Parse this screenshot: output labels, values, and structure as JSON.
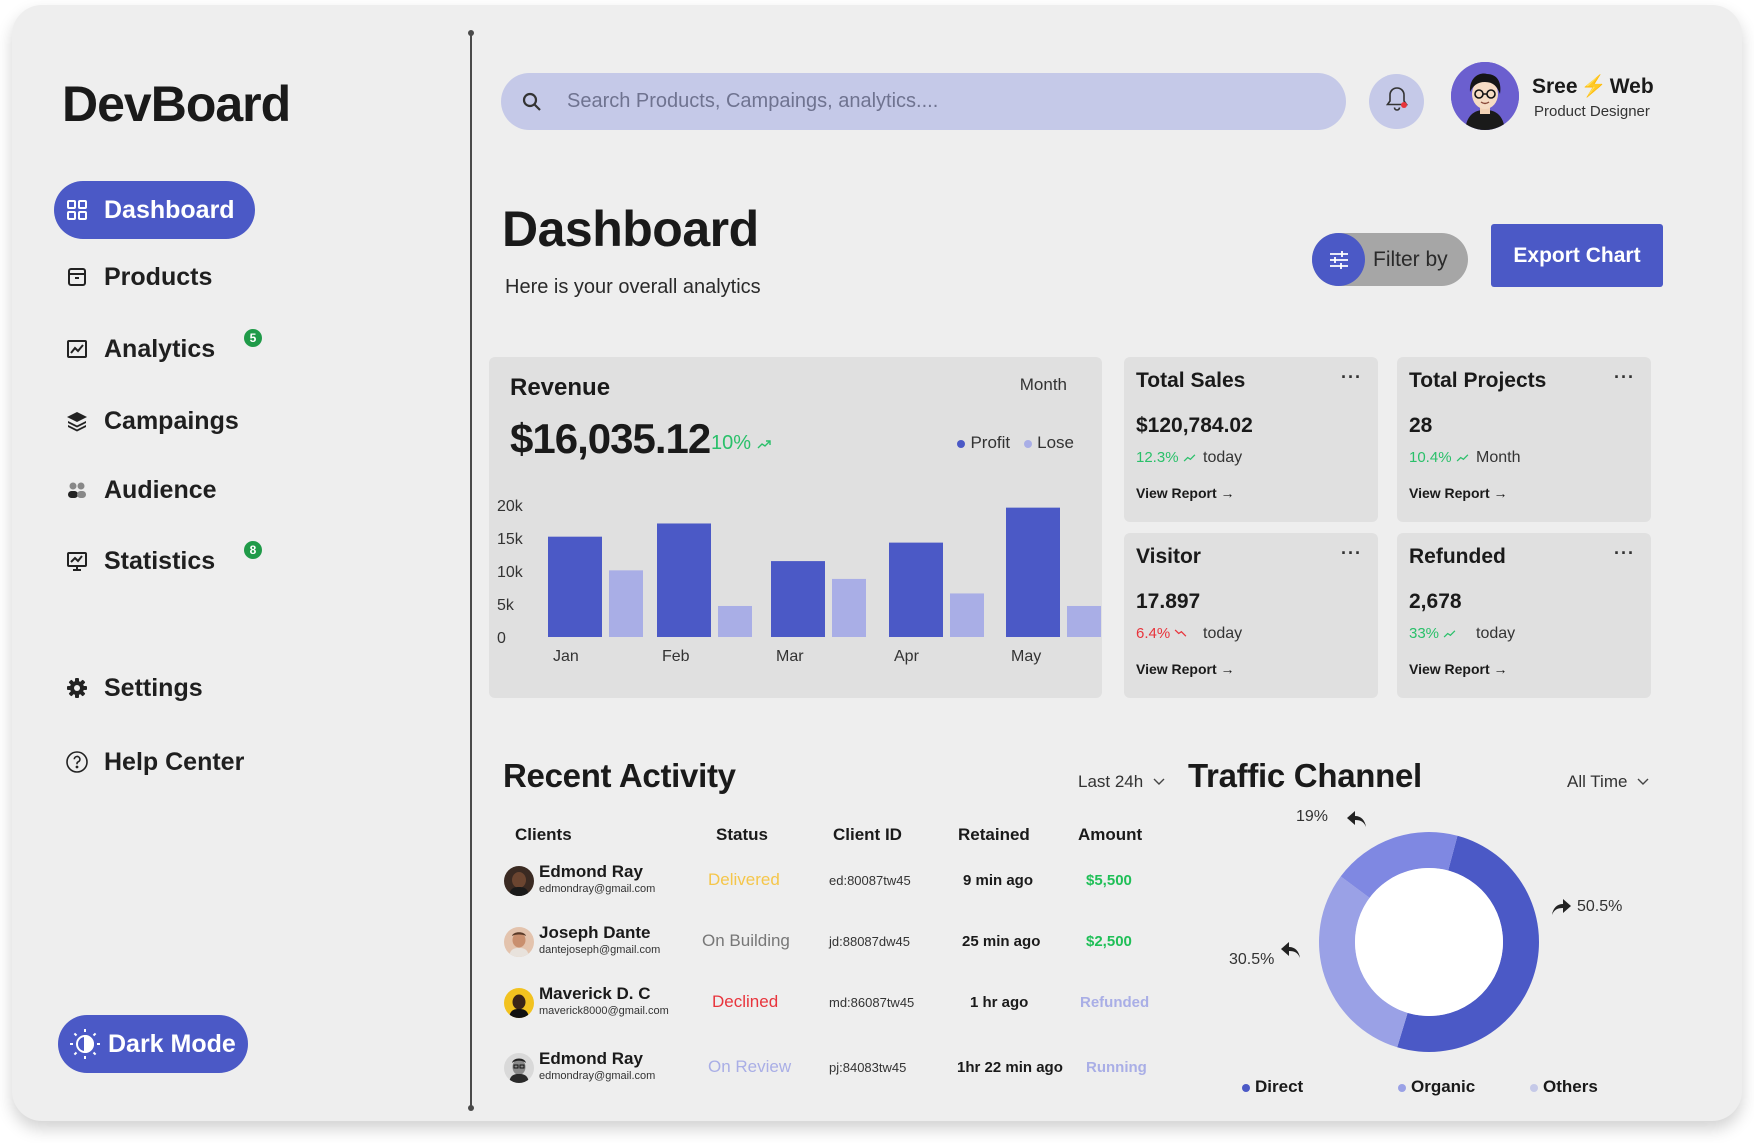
{
  "app": {
    "logo": "DevBoard"
  },
  "sidebar": {
    "items": [
      {
        "label": "Dashboard",
        "icon": "grid-icon"
      },
      {
        "label": "Products",
        "icon": "box-icon"
      },
      {
        "label": "Analytics",
        "icon": "image-chart-icon",
        "badge": "5"
      },
      {
        "label": "Campaings",
        "icon": "layers-icon"
      },
      {
        "label": "Audience",
        "icon": "users-icon"
      },
      {
        "label": "Statistics",
        "icon": "presentation-chart-icon",
        "badge": "8"
      },
      {
        "label": "Settings",
        "icon": "gear-icon"
      },
      {
        "label": "Help Center",
        "icon": "help-circle-icon"
      }
    ],
    "dark_mode_label": "Dark Mode"
  },
  "topbar": {
    "search_placeholder": "Search Products, Campaings, analytics....",
    "user_first": "Sree",
    "user_bolt": "⚡",
    "user_last": "Web",
    "user_role": "Product Designer"
  },
  "header": {
    "title": "Dashboard",
    "subtitle": "Here is your overall analytics",
    "filter_label": "Filter by",
    "export_label": "Export Chart"
  },
  "revenue": {
    "title": "Revenue",
    "period": "Month",
    "value": "$16,035.12",
    "change": "10%",
    "legend": [
      "Profit",
      "Lose"
    ]
  },
  "chart_data": {
    "type": "bar",
    "categories": [
      "Jan",
      "Feb",
      "Mar",
      "Apr",
      "May"
    ],
    "series": [
      {
        "name": "Profit",
        "values": [
          15200,
          17200,
          11500,
          14300,
          19600
        ]
      },
      {
        "name": "Lose",
        "values": [
          10100,
          4700,
          8800,
          6600,
          4700
        ]
      }
    ],
    "yticks": [
      "0",
      "5k",
      "10k",
      "15k",
      "20k"
    ],
    "ylim": [
      0,
      20000
    ],
    "colors": [
      "#4b59c6",
      "#a9aee6"
    ]
  },
  "stats": [
    {
      "title": "Total Sales",
      "value": "$120,784.02",
      "change": "12.3%",
      "trend": "up",
      "when": "today",
      "link": "View Report →"
    },
    {
      "title": "Total Projects",
      "value": "28",
      "change": "10.4%",
      "trend": "up",
      "when": "Month",
      "link": "View Report →"
    },
    {
      "title": "Visitor",
      "value": "17.897",
      "change": "6.4%",
      "trend": "down",
      "when": "today",
      "link": "View Report →"
    },
    {
      "title": "Refunded",
      "value": "2,678",
      "change": "33%",
      "trend": "up",
      "when": "today",
      "link": "View Report →"
    }
  ],
  "activity": {
    "title": "Recent Activity",
    "filter": "Last 24h",
    "columns": [
      "Clients",
      "Status",
      "Client ID",
      "Retained",
      "Amount"
    ],
    "rows": [
      {
        "name": "Edmond Ray",
        "email": "edmondray@gmail.com",
        "status": "Delivered",
        "status_color": "#f5c64a",
        "id": "ed:80087tw45",
        "retained": "9 min ago",
        "amount": "$5,500",
        "amount_color": "#1fbf57"
      },
      {
        "name": "Joseph Dante",
        "email": "dantejoseph@gmail.com",
        "status": "On Building",
        "status_color": "#777777",
        "id": "jd:88087dw45",
        "retained": "25 min ago",
        "amount": "$2,500",
        "amount_color": "#1fbf57"
      },
      {
        "name": "Maverick D. C",
        "email": "maverick8000@gmail.com",
        "status": "Declined",
        "status_color": "#e8343c",
        "id": "md:86087tw45",
        "retained": "1 hr ago",
        "amount": "Refunded",
        "amount_color": "#a9aee6"
      },
      {
        "name": "Edmond Ray",
        "email": "edmondray@gmail.com",
        "status": "On Review",
        "status_color": "#a9aee6",
        "id": "pj:84083tw45",
        "retained": "1hr 22 min ago",
        "amount": "Running",
        "amount_color": "#a9aee6"
      }
    ]
  },
  "traffic": {
    "title": "Traffic Channel",
    "filter": "All Time",
    "channels": [
      {
        "name": "Direct",
        "pct": "50.5%",
        "color": "#4b59c6"
      },
      {
        "name": "Organic",
        "pct": "30.5%",
        "color": "#9aa1e6"
      },
      {
        "name": "Others",
        "pct": "19%",
        "color": "#7f88e2"
      }
    ],
    "shares": [
      50.5,
      30.5,
      19
    ]
  }
}
